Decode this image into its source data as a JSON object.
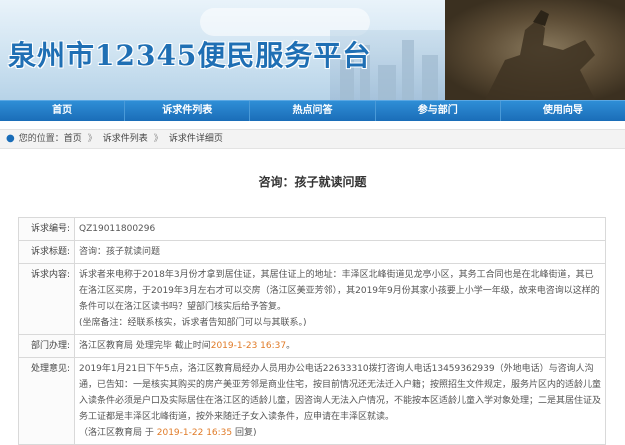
{
  "banner": {
    "title": "泉州市12345便民服务平台"
  },
  "nav": {
    "items": [
      "首页",
      "诉求件列表",
      "热点问答",
      "参与部门",
      "使用向导"
    ]
  },
  "breadcrumb": {
    "prefix": "您的位置：",
    "items": [
      "首页",
      "诉求件列表",
      "诉求件详细页"
    ],
    "separator": "》"
  },
  "page": {
    "heading": "咨询：孩子就读问题"
  },
  "detail": {
    "number_label": "诉求编号:",
    "number": "QZ19011800296",
    "subject_label": "诉求标题:",
    "subject": "咨询：孩子就读问题",
    "content_label": "诉求内容:",
    "content": "诉求者来电称于2018年3月份才拿到居住证，其居住证上的地址：丰泽区北峰街道见龙亭小区，其务工合同也是在北峰街道，其已在洛江区买房，于2019年3月左右才可以交房（洛江区美亚芳邻），其2019年9月份其家小孩要上小学一年级，故来电咨询以这样的条件可以在洛江区读书吗？望部门核实后给予答复。",
    "content_note": "(坐席备注：经联系核实，诉求者告知部门可以与其联系。)",
    "dept_label": "部门办理:",
    "dept_prefix": "洛江区教育局 处理完毕 截止时间",
    "dept_deadline": "2019-1-23 16:37",
    "dept_suffix": "。",
    "opinion_label": "处理意见:",
    "opinion": "2019年1月21日下午5点，洛江区教育局经办人员用办公电话22633310拨打咨询人电话13459362939（外地电话）与咨询人沟通，已告知：一是核实其购买的房产美亚芳邻是商业住宅，按目前情况还无法迁入户籍；按照招生文件规定，服务片区内的适龄儿童入读条件必须是户口及实际居住在洛江区的适龄儿童，因咨询人无法入户情况，不能按本区适龄儿童入学对象处理；二是其居住证及务工证都是丰泽区北峰街道，按外来随迁子女入读条件，应申请在丰泽区就读。",
    "reply_prefix": "（洛江区教育局 于",
    "reply_time": "2019-1-22 16:35",
    "reply_suffix": "回复)"
  },
  "colors": {
    "nav_bg": "#1a6db8",
    "title_blue": "#1f6fb4",
    "highlight": "#e07b28"
  },
  "icons": {
    "breadcrumb": "location-pin-icon"
  }
}
